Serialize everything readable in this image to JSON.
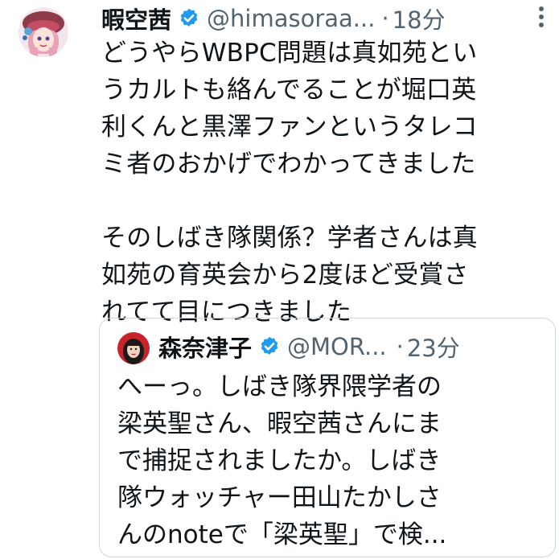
{
  "tweet": {
    "display_name": "暇空茜",
    "handle": "@himasoraa...",
    "separator": "·",
    "time": "18分",
    "lines": [
      "どうやらWBPC問題は真如苑とい",
      "うカルトも絡んでることが堀口英",
      "利くんと黒澤ファンというタレコ",
      "ミ者のおかげでわかってきました",
      "",
      "そのしばき隊関係？学者さんは真",
      "如苑の育英会から2度ほど受賞さ",
      "れてて目につきました"
    ]
  },
  "quote": {
    "display_name": "森奈津子",
    "handle": "@MOR...",
    "separator": "·",
    "time": "23分",
    "lines": [
      "へーっ。しばき隊界隈学者の",
      "梁英聖さん、暇空茜さんにま",
      "で捕捉されましたか。しばき",
      "隊ウォッチャー田山たかしさ",
      "んのnoteで「梁英聖」で検..."
    ]
  },
  "colors": {
    "verified_blue": "#1d9bf0",
    "secondary_text": "#536471",
    "border": "#cfd9de"
  },
  "icons": {
    "verified": "verified-badge-icon",
    "more": "more-options-icon"
  }
}
